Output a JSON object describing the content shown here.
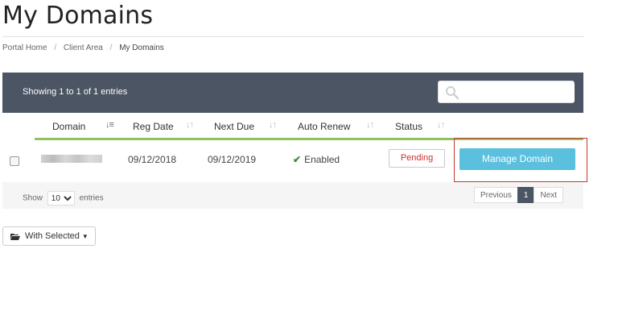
{
  "page": {
    "title": "My Domains"
  },
  "breadcrumb": [
    {
      "label": "Portal Home"
    },
    {
      "label": "Client Area"
    },
    {
      "label": "My Domains"
    }
  ],
  "table": {
    "info": "Showing 1 to 1 of 1 entries",
    "search": {
      "placeholder": "",
      "value": ""
    },
    "columns": [
      "Domain",
      "Reg Date",
      "Next Due",
      "Auto Renew",
      "Status"
    ],
    "rows": [
      {
        "reg_date": "09/12/2018",
        "next_due": "09/12/2019",
        "auto_renew": "Enabled",
        "status": "Pending",
        "action": "Manage Domain"
      }
    ],
    "footer": {
      "show_label": "Show",
      "page_size": "10",
      "entries_label": "entries",
      "prev": "Previous",
      "page": "1",
      "next": "Next"
    }
  },
  "bulk": {
    "label": "With Selected"
  },
  "colors": {
    "header_bar": "#4b5563",
    "accent_green": "#8fc25a",
    "manage_button": "#5bc0de",
    "pending_text": "#c9302c",
    "highlight_border": "#c0392b"
  },
  "icons": {
    "search": "search-icon",
    "sort": "sort-icon",
    "check": "check-icon",
    "folder": "folder-open-icon",
    "caret": "caret-down-icon"
  }
}
